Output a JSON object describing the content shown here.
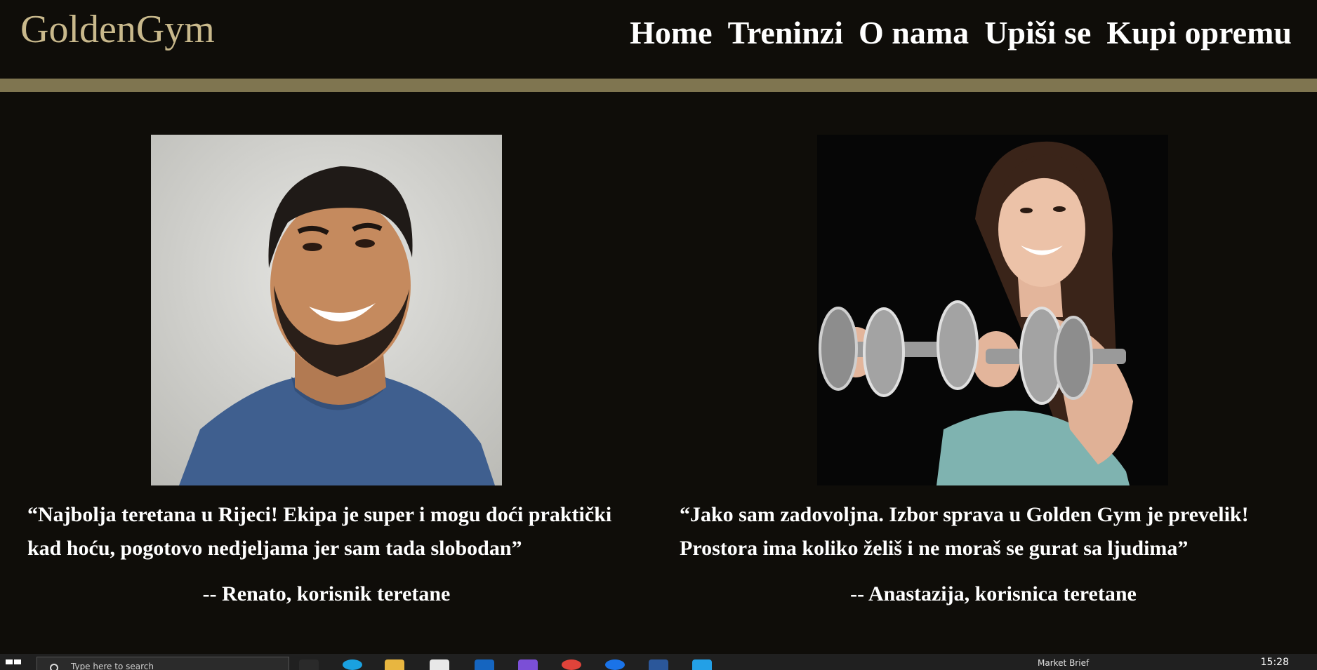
{
  "header": {
    "logo": "GoldenGym",
    "nav": [
      "Home",
      "Treninzi",
      "O nama",
      "Upiši se",
      "Kupi opremu"
    ]
  },
  "testimonials": [
    {
      "quote_line1": "“Najbolja teretana u Rijeci! Ekipa je super i mogu doći praktički",
      "quote_line2": "kad hoću, pogotovo nedjeljama jer sam tada slobodan”",
      "author": "-- Renato, korisnik teretane"
    },
    {
      "quote_line1": "“Jako sam zadovoljna. Izbor sprava u Golden Gym je prevelik!",
      "quote_line2": "Prostora ima koliko želiš i ne moraš se gurat sa ljudima”",
      "author": "-- Anastazija, korisnica teretane"
    }
  ],
  "taskbar": {
    "search_placeholder": "Type here to search",
    "tray_text": "Market Brief",
    "clock": "15:28"
  },
  "colors": {
    "background": "#0f0d09",
    "logo": "#c9b98c",
    "gold_bar": "#7f7550"
  }
}
